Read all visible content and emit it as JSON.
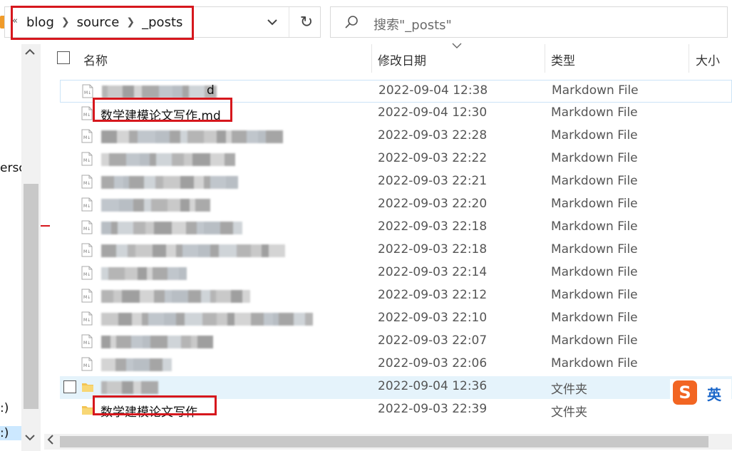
{
  "address": {
    "crumbs": [
      "blog",
      "source",
      "_posts"
    ]
  },
  "search": {
    "placeholder": "搜索\"_posts\""
  },
  "left_nav": {
    "text_cut_1": "ersc",
    "text_cut_2": ":)",
    "text_cut_3": ":)"
  },
  "header": {
    "name": "名称",
    "date": "修改日期",
    "type": "类型",
    "size": "大小"
  },
  "files": [
    {
      "name": "d",
      "date": "2022-09-04 12:38",
      "type": "Markdown File",
      "blurred": true
    },
    {
      "name": "数学建模论文写作.md",
      "date": "2022-09-04 12:30",
      "type": "Markdown File",
      "blurred": false
    },
    {
      "name": "",
      "date": "2022-09-03 22:28",
      "type": "Markdown File",
      "blurred": true
    },
    {
      "name": "",
      "date": "2022-09-03 22:22",
      "type": "Markdown File",
      "blurred": true
    },
    {
      "name": "",
      "date": "2022-09-03 22:21",
      "type": "Markdown File",
      "blurred": true
    },
    {
      "name": "",
      "date": "2022-09-03 22:20",
      "type": "Markdown File",
      "blurred": true
    },
    {
      "name": "",
      "date": "2022-09-03 22:18",
      "type": "Markdown File",
      "blurred": true
    },
    {
      "name": "",
      "date": "2022-09-03 22:18",
      "type": "Markdown File",
      "blurred": true
    },
    {
      "name": "",
      "date": "2022-09-03 22:14",
      "type": "Markdown File",
      "blurred": true
    },
    {
      "name": "",
      "date": "2022-09-03 22:12",
      "type": "Markdown File",
      "blurred": true
    },
    {
      "name": "",
      "date": "2022-09-03 22:10",
      "type": "Markdown File",
      "blurred": true
    },
    {
      "name": "",
      "date": "2022-09-03 22:07",
      "type": "Markdown File",
      "blurred": true
    },
    {
      "name": "",
      "date": "2022-09-03 22:06",
      "type": "Markdown File",
      "blurred": true
    }
  ],
  "folders": [
    {
      "name": "",
      "date": "2022-09-04 12:36",
      "type": "文件夹",
      "blurred": true
    },
    {
      "name": "数学建模论文写作",
      "date": "2022-09-03 22:39",
      "type": "文件夹",
      "blurred": false
    }
  ],
  "ime": {
    "icon": "sogou-ime-icon",
    "mode": "英"
  },
  "colors": {
    "highlight_box": "#d6171d",
    "hover_row": "#e5f3fb",
    "ime_brand": "#f26522"
  }
}
